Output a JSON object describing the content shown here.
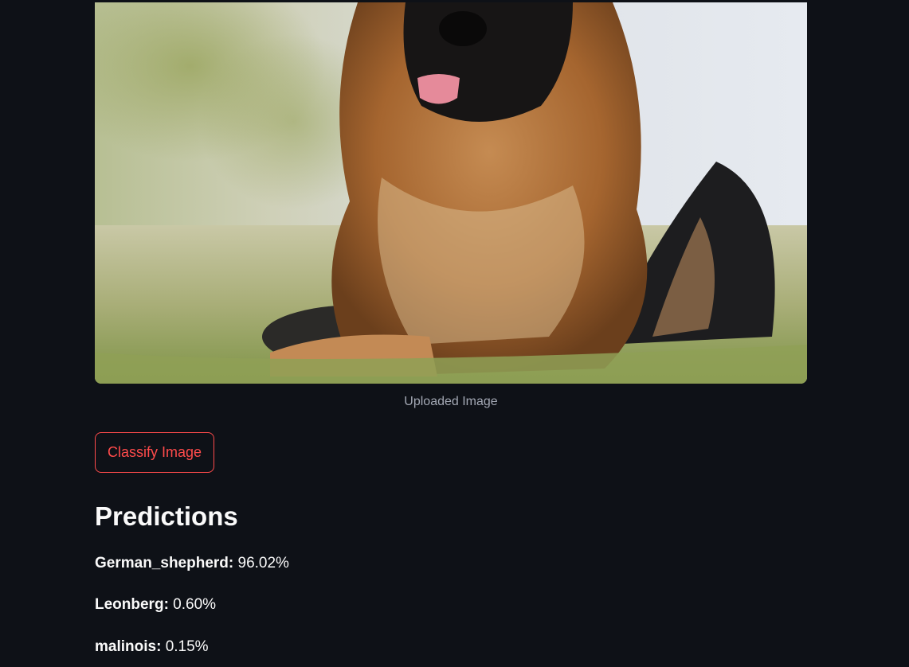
{
  "image": {
    "caption": "Uploaded Image",
    "subject": "german-shepherd-dog-photo"
  },
  "classify_button": {
    "label": "Classify Image"
  },
  "predictions": {
    "title": "Predictions",
    "separator": ":",
    "items": [
      {
        "label": "German_shepherd",
        "value": "96.02%"
      },
      {
        "label": "Leonberg",
        "value": "0.60%"
      },
      {
        "label": "malinois",
        "value": "0.15%"
      }
    ]
  },
  "colors": {
    "background": "#0e1117",
    "accent": "#ff4b4b",
    "text": "#fafafa",
    "caption": "#a3a8b4"
  }
}
